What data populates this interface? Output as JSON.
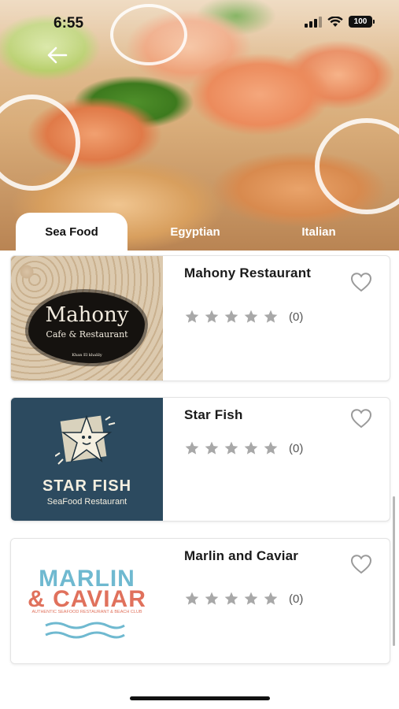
{
  "status": {
    "time": "6:55",
    "battery": "100"
  },
  "tabs": [
    {
      "label": "Sea Food",
      "active": true
    },
    {
      "label": "Egyptian",
      "active": false
    },
    {
      "label": "Italian",
      "active": false
    }
  ],
  "restaurants": [
    {
      "name": "Mahony Restaurant",
      "rating": 0,
      "review_count": "(0)",
      "logo": {
        "title": "Mahony",
        "subtitle": "Cafe & Restaurant",
        "tagline": "Khan El khalily"
      }
    },
    {
      "name": "Star Fish",
      "rating": 0,
      "review_count": "(0)",
      "logo": {
        "title": "STAR FISH",
        "subtitle": "SeaFood Restaurant"
      }
    },
    {
      "name": "Marlin and Caviar",
      "rating": 0,
      "review_count": "(0)",
      "logo": {
        "title_line1": "MARLIN",
        "title_line2": "& CAVIAR",
        "subtitle": "AUTHENTIC SEAFOOD RESTAURANT & BEACH CLUB"
      }
    }
  ],
  "colors": {
    "star_inactive": "#a8a8a8",
    "heart_outline": "#9a9a9a",
    "starfish_bg": "#2c4a5f",
    "marlin_blue": "#6fb9d0",
    "marlin_red": "#e0715c"
  },
  "icons": {
    "back": "arrow-left-icon",
    "favorite": "heart-outline-icon",
    "rating": "star-icon"
  }
}
